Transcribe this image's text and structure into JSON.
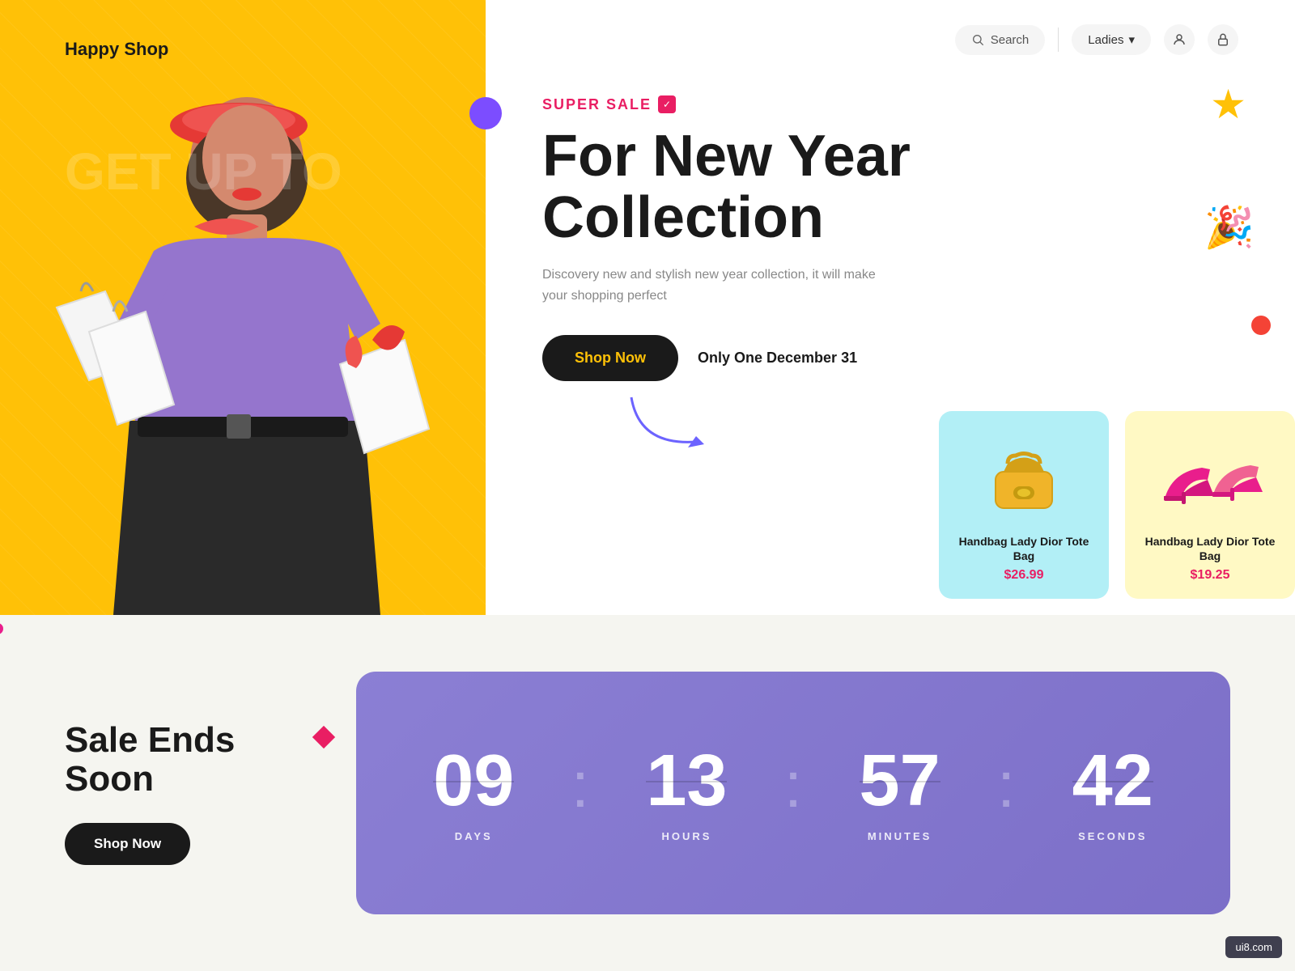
{
  "brand": {
    "name": "Happy Shop"
  },
  "nav": {
    "search_placeholder": "Search",
    "ladies_label": "Ladies",
    "chevron": "▾"
  },
  "hero": {
    "super_sale_label": "SUPER SALE",
    "title_line1": "For New Year",
    "title_line2": "Collection",
    "description": "Discovery new and stylish new year collection, it will make your shopping perfect",
    "shop_now_label": "Shop Now",
    "only_one_label": "Only One December 31"
  },
  "products": [
    {
      "name": "Handbag Lady Dior Tote Bag",
      "price": "$26.99",
      "bg": "blue"
    },
    {
      "name": "Handbag Lady Dior Tote Bag",
      "price": "$19.25",
      "bg": "yellow"
    }
  ],
  "sale_section": {
    "title_line1": "Sale Ends",
    "title_line2": "Soon",
    "shop_now_label": "Shop Now"
  },
  "countdown": {
    "days_value": "09",
    "days_label": "DAYS",
    "hours_value": "13",
    "hours_label": "HOURS",
    "minutes_value": "57",
    "minutes_label": "MINUTES",
    "seconds_value": "42",
    "seconds_label": "SECONDS"
  },
  "watermark": {
    "text": "ui8.com"
  },
  "get_up_text": "GET UP TO"
}
